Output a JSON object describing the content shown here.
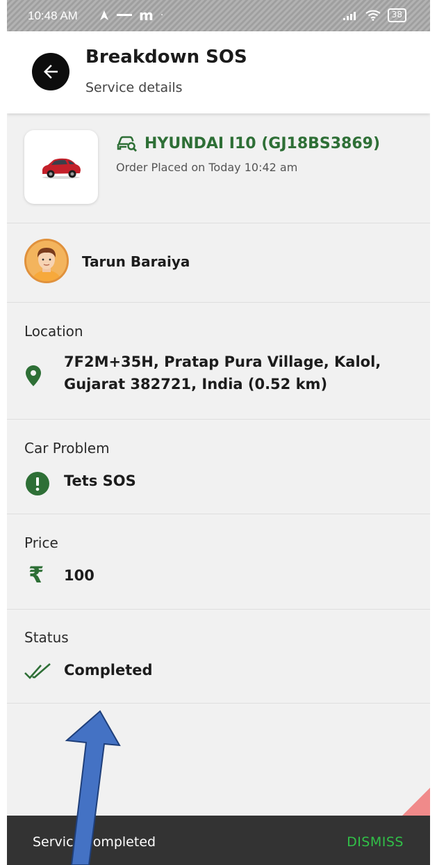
{
  "status_bar": {
    "time": "10:48 AM",
    "battery": "38"
  },
  "header": {
    "title": "Breakdown SOS",
    "subtitle": "Service details"
  },
  "vehicle": {
    "name": "HYUNDAI I10 (GJ18BS3869)",
    "order_placed": "Order Placed on Today 10:42 am"
  },
  "user": {
    "name": "Tarun Baraiya"
  },
  "location": {
    "label": "Location",
    "address_line1": "7F2M+35H, Pratap Pura Village, Kalol,",
    "address_line2": "Gujarat 382721, India (0.52 km)"
  },
  "car_problem": {
    "label": "Car Problem",
    "value": "Tets SOS"
  },
  "price": {
    "label": "Price",
    "currency_symbol": "₹",
    "value": "100"
  },
  "status": {
    "label": "Status",
    "value": "Completed"
  },
  "snackbar": {
    "message": "Service completed",
    "action": "DISMISS"
  },
  "colors": {
    "accent_green": "#2e6f36",
    "dismiss_green": "#31c048",
    "snackbar_bg": "#333333",
    "annotation_arrow": "#4472c4"
  },
  "icons": {
    "back": "arrow-left-icon",
    "vehicle": "car-search-icon",
    "location": "map-pin-icon",
    "problem": "alert-icon",
    "price": "rupee-icon",
    "status": "double-check-icon"
  }
}
